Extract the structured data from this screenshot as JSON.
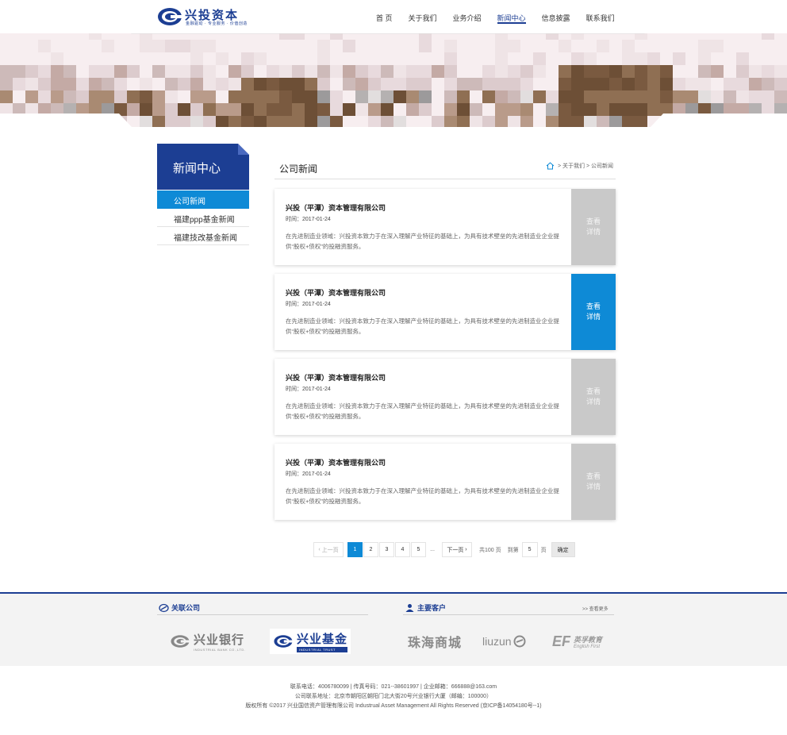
{
  "header": {
    "logo_name": "兴投资本",
    "logo_slogan": "金融驱动 · 专业服务 · 价值创造",
    "nav": [
      "首 页",
      "关于我们",
      "业务介绍",
      "新闻中心",
      "信息披露",
      "联系我们"
    ],
    "active_nav": 3
  },
  "sidebar": {
    "title": "新闻中心",
    "items": [
      "公司新闻",
      "福建ppp基金新闻",
      "福建技改基金新闻"
    ],
    "active": 0
  },
  "main": {
    "title": "公司新闻",
    "breadcrumb": "> 关于我们 > 公司新闻",
    "news": [
      {
        "title": "兴投（平潭）资本管理有限公司",
        "date": "时间：2017-01-24",
        "desc": "在先进制造业领域：兴投资本致力于在深入理解产业特征的基础上，为具有技术壁垒的先进制造业企业提供“股权+债权”的投融资服务。",
        "more": "查看 详情"
      },
      {
        "title": "兴投（平潭）资本管理有限公司",
        "date": "时间：2017-01-24",
        "desc": "在先进制造业领域：兴投资本致力于在深入理解产业特征的基础上，为具有技术壁垒的先进制造业企业提供“股权+债权”的投融资服务。",
        "more": "查看 详情"
      },
      {
        "title": "兴投（平潭）资本管理有限公司",
        "date": "时间：2017-01-24",
        "desc": "在先进制造业领域：兴投资本致力于在深入理解产业特征的基础上，为具有技术壁垒的先进制造业企业提供“股权+债权”的投融资服务。",
        "more": "查看 详情"
      },
      {
        "title": "兴投（平潭）资本管理有限公司",
        "date": "时间：2017-01-24",
        "desc": "在先进制造业领域：兴投资本致力于在深入理解产业特征的基础上，为具有技术壁垒的先进制造业企业提供“股权+债权”的投融资服务。",
        "more": "查看 详情"
      }
    ],
    "highlighted_card": 1
  },
  "pager": {
    "prev": "上一页",
    "pages": [
      "1",
      "2",
      "3",
      "4",
      "5"
    ],
    "current": "1",
    "dots": "...",
    "next": "下一页",
    "total": "共100 页",
    "goto": "到第",
    "goto_value": "5",
    "page_unit": "页",
    "ok": "确定"
  },
  "partners": {
    "related_title": "关联公司",
    "clients_title": "主要客户",
    "more": ">> 查看更多",
    "related": [
      {
        "cn": "兴业银行",
        "en": "INDUSTRIAL BANK CO.,LTD."
      },
      {
        "cn": "兴业基金",
        "en": "INDUSTRIAL TRUST"
      }
    ],
    "clients": [
      "珠海商城",
      "liuzun",
      "英孚教育",
      "English First"
    ]
  },
  "footer": {
    "line1": "联系电话：4006780099 | 传真号码：021--38601997 | 企业邮箱：666888@163.com",
    "line2": "公司联系地址：北京市朝阳区朝阳门北大街20号兴业银行大厦（邮编：100000）",
    "line3": "版权所有 ©2017 兴业国信资产管理有限公司 Industrual Asset Management All Rights Reserved (京ICP备14054180号--1)"
  },
  "colors": {
    "brand": "#1c3e93",
    "accent": "#0e8ad6",
    "card_more": "#c9c9c9"
  }
}
